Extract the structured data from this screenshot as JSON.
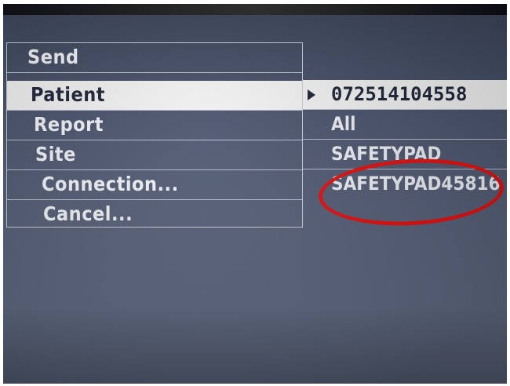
{
  "menu": {
    "items": [
      {
        "label": "Send"
      },
      {
        "label": "Patient"
      },
      {
        "label": "Report"
      },
      {
        "label": "Site"
      },
      {
        "label": "Connection..."
      },
      {
        "label": "Cancel..."
      }
    ],
    "selected_index": 1
  },
  "values": {
    "patient": "072514104558",
    "report": "All",
    "site": "SAFETYPAD",
    "connection": "SAFETYPAD45816"
  },
  "colors": {
    "screen_bg": "#4a546d",
    "highlight_bg": "#f3f3f3",
    "annotation_circle": "#e31010"
  }
}
